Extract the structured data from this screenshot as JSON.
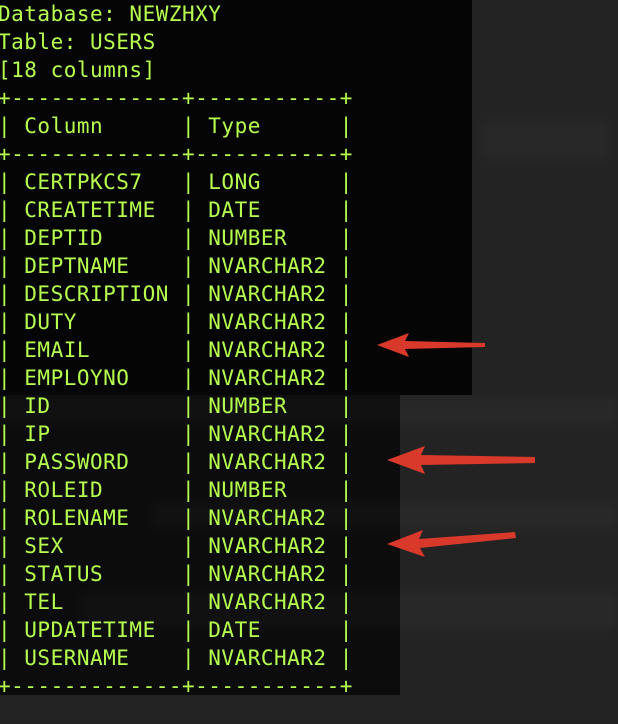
{
  "header": {
    "database_line": "Database: NEWZHXY",
    "table_line": "Table: USERS",
    "columns_line": "[18 columns]"
  },
  "table": {
    "border_line": "+-------------+-----------+",
    "headers": {
      "column": "Column",
      "type": "Type"
    },
    "rows": [
      {
        "column": "CERTPKCS7",
        "type": "LONG"
      },
      {
        "column": "CREATETIME",
        "type": "DATE"
      },
      {
        "column": "DEPTID",
        "type": "NUMBER"
      },
      {
        "column": "DEPTNAME",
        "type": "NVARCHAR2"
      },
      {
        "column": "DESCRIPTION",
        "type": "NVARCHAR2"
      },
      {
        "column": "DUTY",
        "type": "NVARCHAR2"
      },
      {
        "column": "EMAIL",
        "type": "NVARCHAR2"
      },
      {
        "column": "EMPLOYNO",
        "type": "NVARCHAR2"
      },
      {
        "column": "ID",
        "type": "NUMBER"
      },
      {
        "column": "IP",
        "type": "NVARCHAR2"
      },
      {
        "column": "PASSWORD",
        "type": "NVARCHAR2"
      },
      {
        "column": "ROLEID",
        "type": "NUMBER"
      },
      {
        "column": "ROLENAME",
        "type": "NVARCHAR2"
      },
      {
        "column": "SEX",
        "type": "NVARCHAR2"
      },
      {
        "column": "STATUS",
        "type": "NVARCHAR2"
      },
      {
        "column": "TEL",
        "type": "NVARCHAR2"
      },
      {
        "column": "UPDATETIME",
        "type": "DATE"
      },
      {
        "column": "USERNAME",
        "type": "NVARCHAR2"
      }
    ]
  },
  "colors": {
    "terminal_text": "#b6ff4f",
    "annotation_arrow": "#d8392b"
  },
  "annotations": [
    {
      "icon": "arrow-left-icon",
      "points_to": "EMAIL"
    },
    {
      "icon": "arrow-left-icon",
      "points_to": "PASSWORD"
    },
    {
      "icon": "arrow-left-icon",
      "points_to": "SEX"
    }
  ]
}
